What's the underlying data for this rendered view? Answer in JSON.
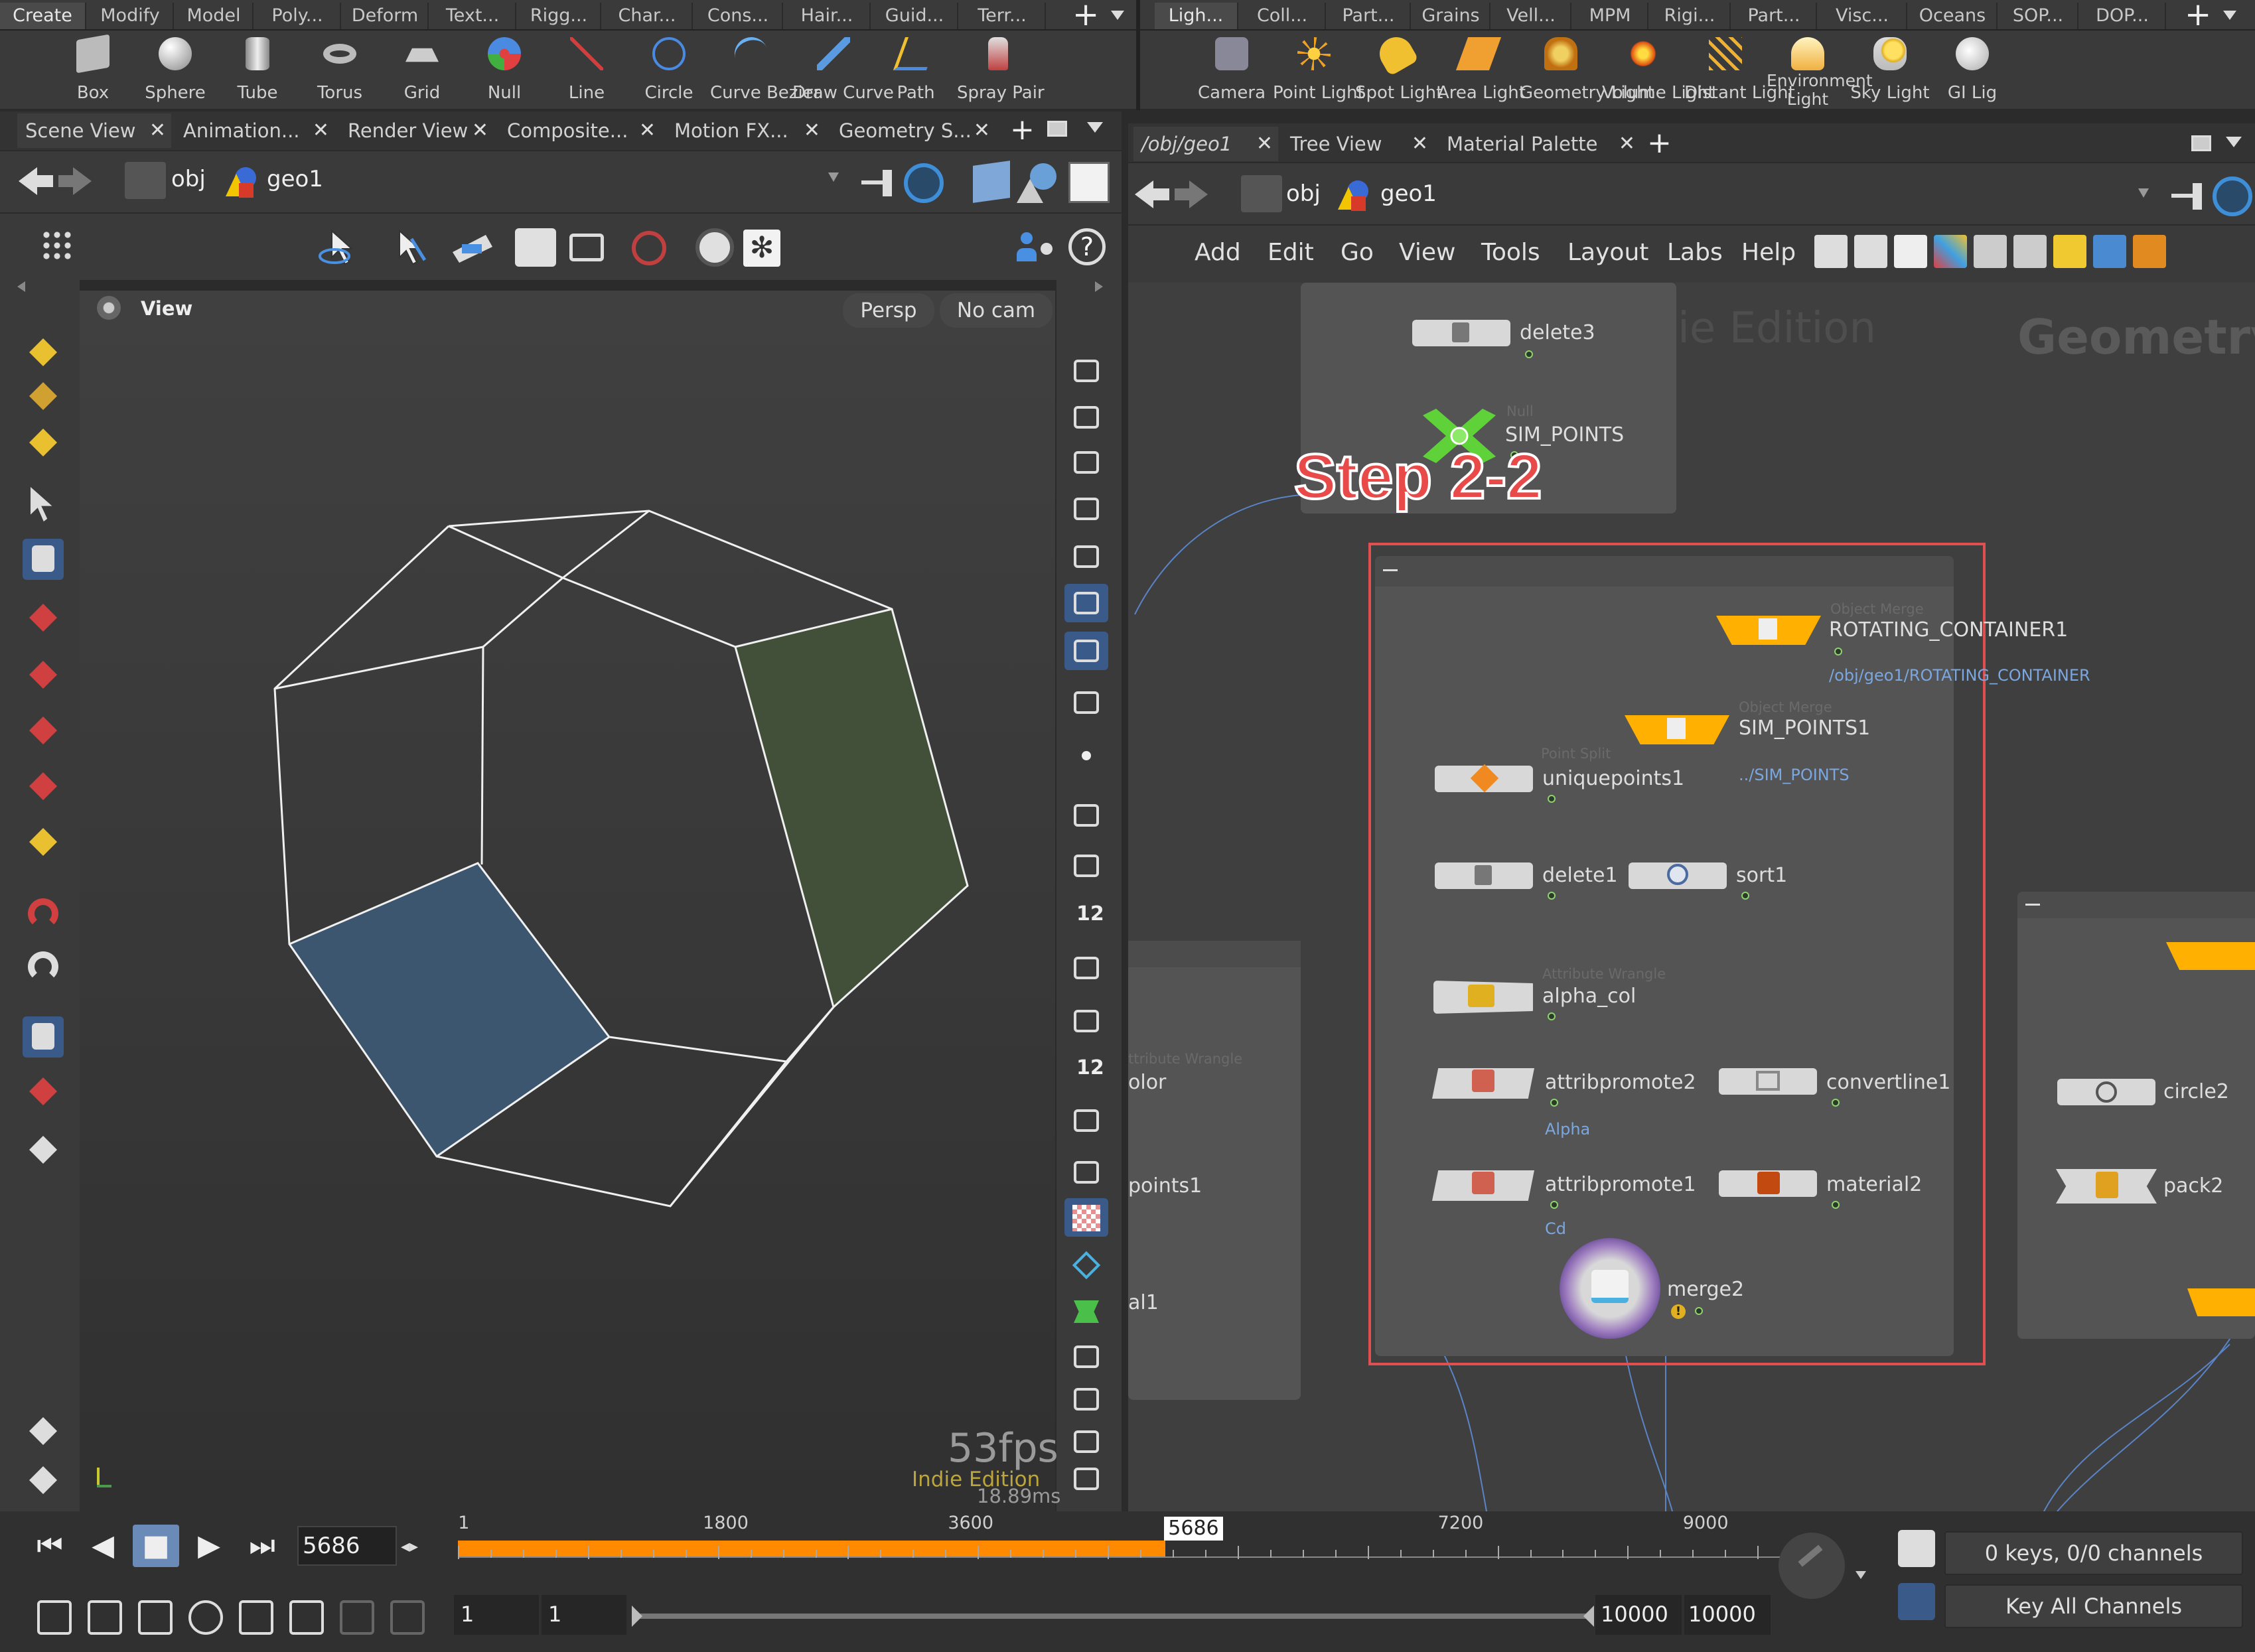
{
  "top_shelf_left": {
    "tabs": [
      "Create",
      "Modify",
      "Model",
      "Poly...",
      "Deform",
      "Text...",
      "Rigg...",
      "Char...",
      "Cons...",
      "Hair...",
      "Guid...",
      "Terr..."
    ],
    "tools": [
      {
        "label": "Box",
        "icon": "box-icon"
      },
      {
        "label": "Sphere",
        "icon": "sphere-icon"
      },
      {
        "label": "Tube",
        "icon": "tube-icon"
      },
      {
        "label": "Torus",
        "icon": "torus-icon"
      },
      {
        "label": "Grid",
        "icon": "grid-icon"
      },
      {
        "label": "Null",
        "icon": "null-icon"
      },
      {
        "label": "Line",
        "icon": "line-icon"
      },
      {
        "label": "Circle",
        "icon": "circle-icon"
      },
      {
        "label": "Curve Bezier",
        "icon": "curve-bezier-icon"
      },
      {
        "label": "Draw Curve",
        "icon": "draw-curve-icon"
      },
      {
        "label": "Path",
        "icon": "path-icon"
      },
      {
        "label": "Spray Pair",
        "icon": "spray-paint-icon"
      }
    ]
  },
  "top_shelf_right": {
    "tabs": [
      "Ligh...",
      "Coll...",
      "Part...",
      "Grains",
      "Vell...",
      "MPM",
      "Rigi...",
      "Part...",
      "Visc...",
      "Oceans",
      "SOP...",
      "DOP..."
    ],
    "tools": [
      {
        "label": "Camera",
        "icon": "camera-icon"
      },
      {
        "label": "Point Light",
        "icon": "point-light-icon"
      },
      {
        "label": "Spot Light",
        "icon": "spot-light-icon"
      },
      {
        "label": "Area Light",
        "icon": "area-light-icon"
      },
      {
        "label": "Geometry Light",
        "icon": "geometry-light-icon"
      },
      {
        "label": "Volume Light",
        "icon": "volume-light-icon"
      },
      {
        "label": "Distant Light",
        "icon": "distant-light-icon"
      },
      {
        "label": "Environment Light",
        "icon": "environment-light-icon"
      },
      {
        "label": "Sky Light",
        "icon": "sky-light-icon"
      },
      {
        "label": "GI Lig",
        "icon": "gi-light-icon"
      }
    ]
  },
  "left_panel": {
    "tabs": [
      "Scene View",
      "Animation...",
      "Render View",
      "Composite...",
      "Motion FX...",
      "Geometry S..."
    ],
    "path": {
      "root": "obj",
      "node": "geo1"
    },
    "viewport": {
      "label": "View",
      "persp": "Persp",
      "cam": "No cam",
      "fps": "53fps",
      "edition": "Indie Edition",
      "ms": "18.89ms"
    }
  },
  "right_panel": {
    "tabs": [
      "/obj/geo1",
      "Tree View",
      "Material Palette"
    ],
    "path": {
      "root": "obj",
      "node": "geo1"
    },
    "menu": [
      "Add",
      "Edit",
      "Go",
      "View",
      "Tools",
      "Layout",
      "Labs",
      "Help"
    ],
    "watermark_left": "Indie Edition",
    "watermark_right": "Geometry",
    "annotation": "Step 2-2",
    "nodes": {
      "delete3": "delete3",
      "sim_points_null_type": "Null",
      "sim_points": "SIM_POINTS",
      "rotating_type": "Object Merge",
      "rotating": "ROTATING_CONTAINER1",
      "rotating_sub": "/obj/geo1/ROTATING_CONTAINER",
      "sim1_type": "Object Merge",
      "sim1": "SIM_POINTS1",
      "sim1_sub": "../SIM_POINTS",
      "unique_type": "Point Split",
      "unique": "uniquepoints1",
      "delete1": "delete1",
      "sort1": "sort1",
      "alpha_type": "Attribute Wrangle",
      "alpha": "alpha_col",
      "promote2": "attribpromote2",
      "promote2_sub": "Alpha",
      "convertline": "convertline1",
      "promote1": "attribpromote1",
      "promote1_sub": "Cd",
      "material2": "material2",
      "merge2": "merge2",
      "left_wrangle_type": "ttribute Wrangle",
      "left_color": "olor",
      "left_points": "points1",
      "left_al": "al1",
      "circle2": "circle2",
      "pack2": "pack2"
    }
  },
  "timeline": {
    "frame": "5686",
    "ticks": [
      "1",
      "1800",
      "3600",
      "5686",
      "7200",
      "9000"
    ],
    "progress": 0.565,
    "range_start_a": "1",
    "range_start_b": "1",
    "range_end_a": "10000",
    "range_end_b": "10000",
    "keys": "0 keys, 0/0 channels",
    "key_all": "Key All Channels"
  },
  "colors": {
    "accent": "#ff8a00",
    "annotation": "#e84a4a",
    "selection_box": "#e05050",
    "node_yellow": "#ffb000"
  }
}
